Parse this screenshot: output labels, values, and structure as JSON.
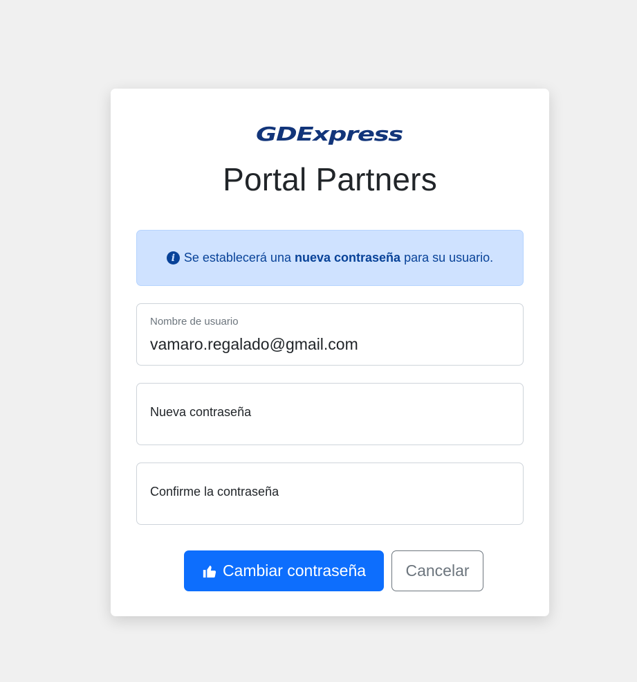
{
  "brand": {
    "logo_text": "GDExpress",
    "title": "Portal Partners",
    "colors": {
      "logo": "#12357a",
      "accent": "#0d6efd"
    }
  },
  "alert": {
    "icon": "info-circle-icon",
    "text_before": "Se establecerá una",
    "text_bold": "nueva contraseña",
    "text_after": "para su usuario."
  },
  "form": {
    "username": {
      "label": "Nombre de usuario",
      "value": "vamaro.regalado@gmail.com"
    },
    "new_password": {
      "placeholder": "Nueva contraseña"
    },
    "confirm_password": {
      "placeholder": "Confirme la contraseña"
    }
  },
  "actions": {
    "submit_icon": "thumbs-up-icon",
    "submit_label": "Cambiar contraseña",
    "cancel_label": "Cancelar"
  }
}
